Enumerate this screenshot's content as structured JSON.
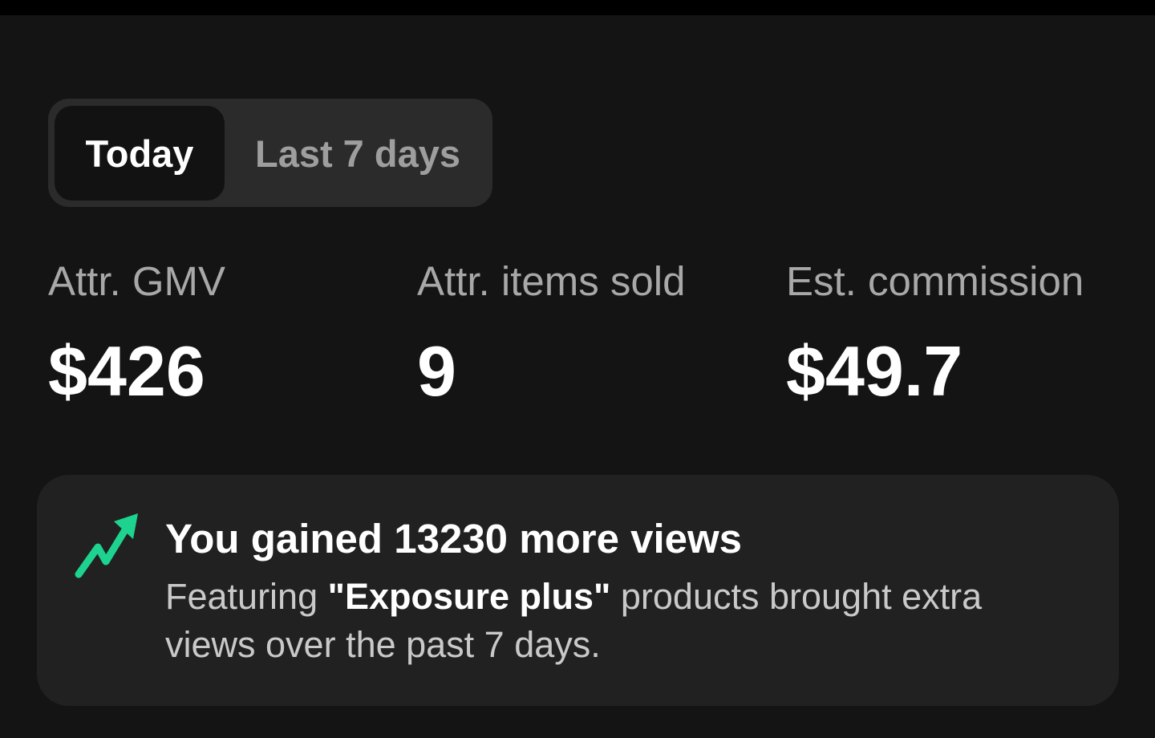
{
  "tabs": {
    "active_label": "Today",
    "inactive_label": "Last 7 days"
  },
  "metrics": [
    {
      "label": "Attr. GMV",
      "value": "$426"
    },
    {
      "label": "Attr. items sold",
      "value": "9"
    },
    {
      "label": "Est. commission",
      "value": "$49.7"
    }
  ],
  "banner": {
    "icon": "trending-up-icon",
    "title": "You gained 13230 more views",
    "desc_before": "Featuring ",
    "desc_highlight": "\"Exposure plus\"",
    "desc_after": " products brought extra views over the past 7 days."
  },
  "colors": {
    "background": "#141414",
    "card": "#212121",
    "accent_green": "#1ed38f"
  }
}
